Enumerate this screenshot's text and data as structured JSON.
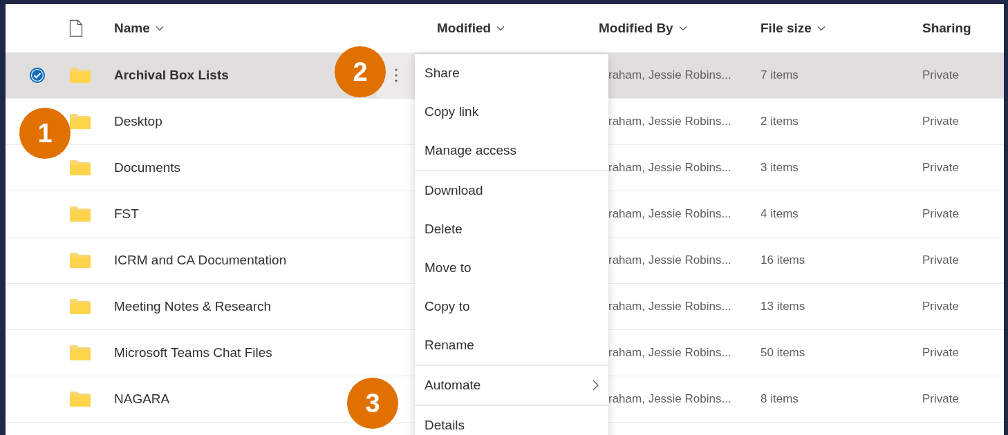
{
  "columns": [
    {
      "label": "Name",
      "dropdown": true
    },
    {
      "label": "Modified",
      "dropdown": true
    },
    {
      "label": "Modified By",
      "dropdown": true
    },
    {
      "label": "File size",
      "dropdown": true
    },
    {
      "label": "Sharing",
      "dropdown": false
    }
  ],
  "rows": [
    {
      "name": "Archival Box Lists",
      "modified_by": "raham, Jessie Robins...",
      "file_size": "7 items",
      "sharing": "Private",
      "selected": true
    },
    {
      "name": "Desktop",
      "modified_by": "raham, Jessie Robins...",
      "file_size": "2 items",
      "sharing": "Private",
      "selected": false
    },
    {
      "name": "Documents",
      "modified_by": "raham, Jessie Robins...",
      "file_size": "3 items",
      "sharing": "Private",
      "selected": false
    },
    {
      "name": "FST",
      "modified_by": "raham, Jessie Robins...",
      "file_size": "4 items",
      "sharing": "Private",
      "selected": false
    },
    {
      "name": "ICRM and CA Documentation",
      "modified_by": "raham, Jessie Robins...",
      "file_size": "16 items",
      "sharing": "Private",
      "selected": false
    },
    {
      "name": "Meeting Notes & Research",
      "modified_by": "raham, Jessie Robins...",
      "file_size": "13 items",
      "sharing": "Private",
      "selected": false
    },
    {
      "name": "Microsoft Teams Chat Files",
      "modified_by": "raham, Jessie Robins...",
      "file_size": "50 items",
      "sharing": "Private",
      "selected": false
    },
    {
      "name": "NAGARA",
      "modified_by": "raham, Jessie Robins...",
      "file_size": "8 items",
      "sharing": "Private",
      "selected": false
    }
  ],
  "context_menu": {
    "groups": [
      {
        "items": [
          {
            "label": "Share",
            "submenu": false
          },
          {
            "label": "Copy link",
            "submenu": false
          },
          {
            "label": "Manage access",
            "submenu": false
          }
        ]
      },
      {
        "items": [
          {
            "label": "Download",
            "submenu": false
          },
          {
            "label": "Delete",
            "submenu": false
          },
          {
            "label": "Move to",
            "submenu": false
          },
          {
            "label": "Copy to",
            "submenu": false
          },
          {
            "label": "Rename",
            "submenu": false
          }
        ]
      },
      {
        "items": [
          {
            "label": "Automate",
            "submenu": true
          }
        ]
      },
      {
        "items": [
          {
            "label": "Details",
            "submenu": false
          }
        ]
      }
    ]
  },
  "callouts": [
    {
      "label": "1"
    },
    {
      "label": "2"
    },
    {
      "label": "3"
    }
  ]
}
